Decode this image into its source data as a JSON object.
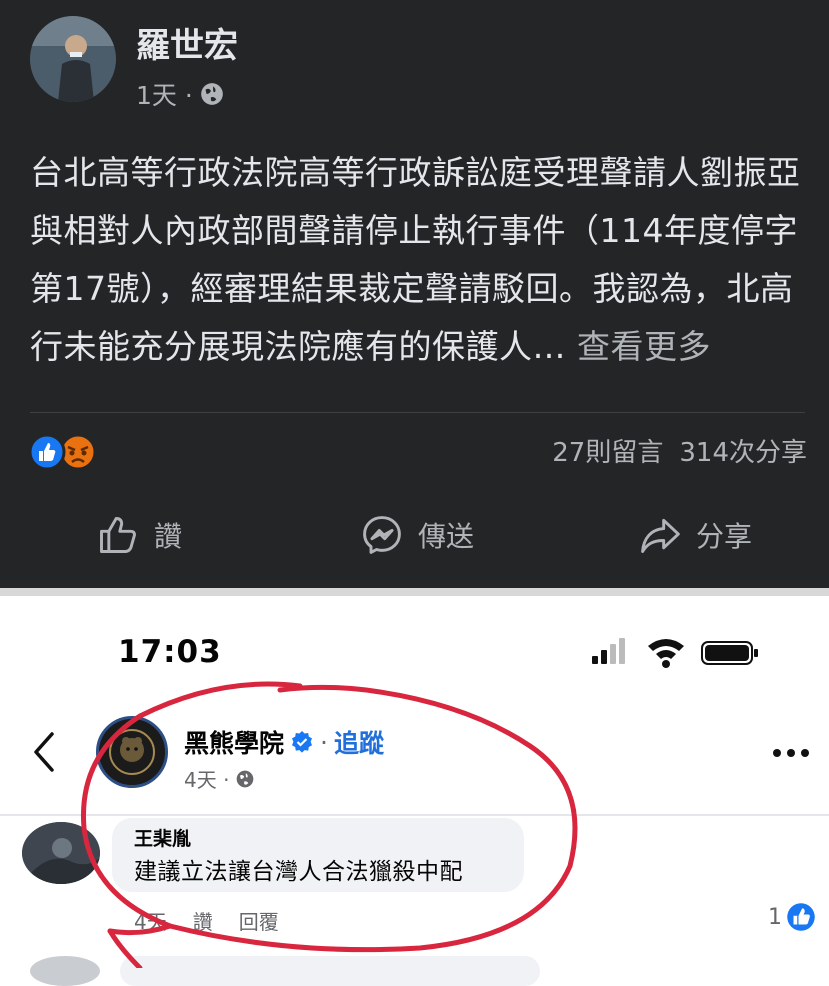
{
  "post": {
    "author": "羅世宏",
    "time": "1天 ·",
    "text": "台北高等行政法院高等行政訴訟庭受理聲請人劉振亞與相對人內政部間聲請停止執行事件（114年度停字第17號），經審理結果裁定聲請駁回。我認為，北高行未能充分展現法院應有的保護人…",
    "see_more": "查看更多",
    "comments": "27則留言",
    "shares": "314次分享",
    "actions": {
      "like": "讚",
      "send": "傳送",
      "share": "分享"
    }
  },
  "status_bar": {
    "time": "17:03"
  },
  "page_header": {
    "name": "黑熊學院",
    "separator": "·",
    "follow": "追蹤",
    "time": "4天 ·"
  },
  "comment": {
    "author": "王棐胤",
    "text": "建議立法讓台灣人合法獵殺中配",
    "time": "4天",
    "like": "讚",
    "reply": "回覆",
    "like_count": "1"
  },
  "colors": {
    "dark_bg": "#242526",
    "link_blue": "#216fdb",
    "annotation_red": "#d7263d"
  }
}
